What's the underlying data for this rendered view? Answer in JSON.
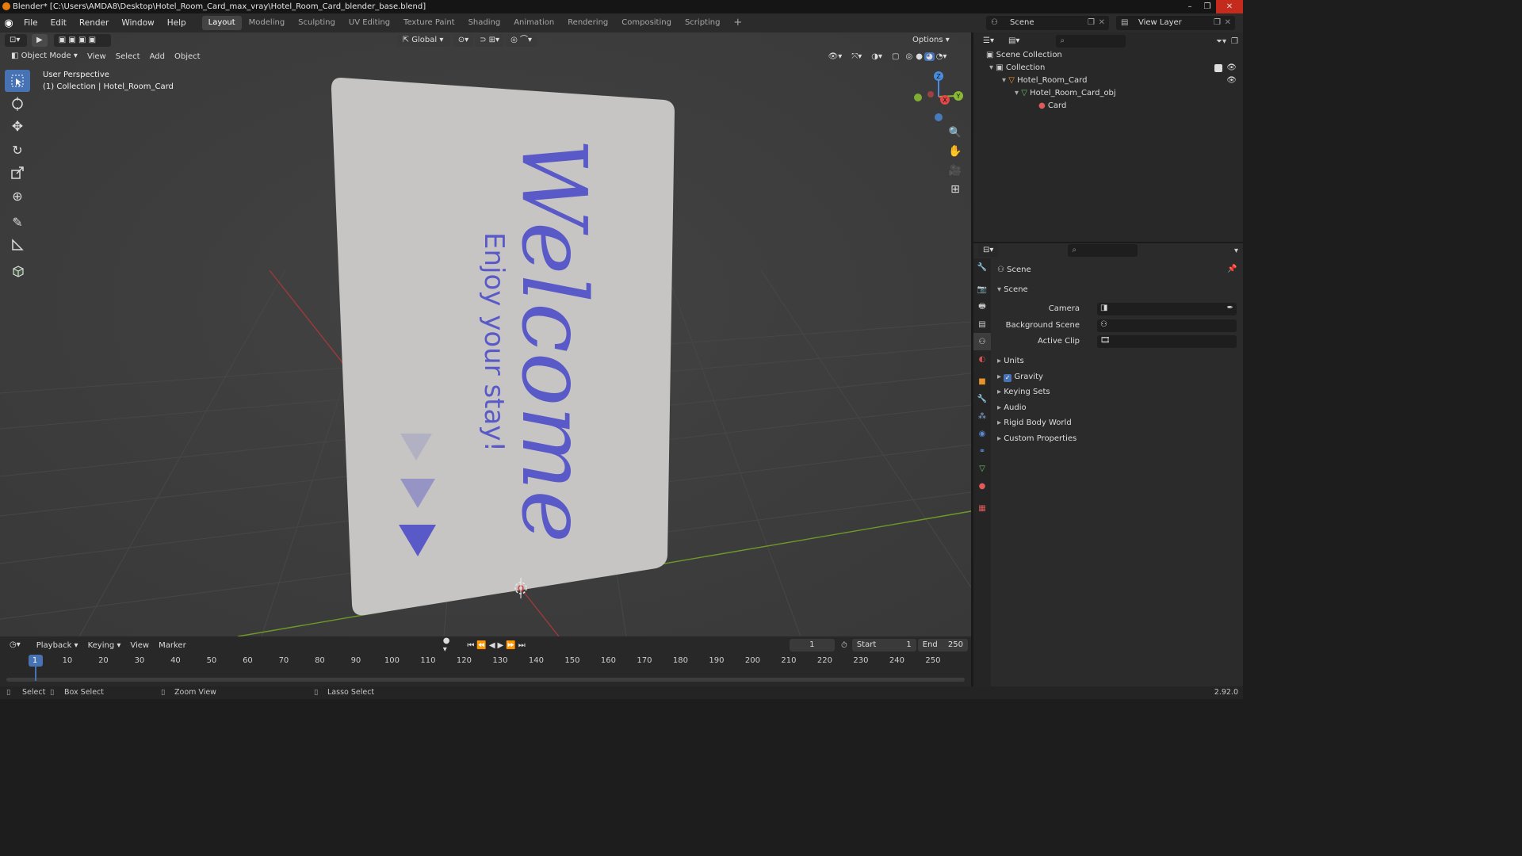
{
  "window": {
    "title": "Blender* [C:\\Users\\AMDA8\\Desktop\\Hotel_Room_Card_max_vray\\Hotel_Room_Card_blender_base.blend]",
    "controls": [
      "–",
      "❐",
      "✕"
    ]
  },
  "menubar": {
    "menus": [
      "File",
      "Edit",
      "Render",
      "Window",
      "Help"
    ],
    "workspaces": [
      "Layout",
      "Modeling",
      "Sculpting",
      "UV Editing",
      "Texture Paint",
      "Shading",
      "Animation",
      "Rendering",
      "Compositing",
      "Scripting"
    ],
    "active_workspace": "Layout",
    "add_workspace": "+",
    "scene": "Scene",
    "view_layer": "View Layer"
  },
  "viewport": {
    "transform_orientation": "Global",
    "options_label": "Options",
    "mode": "Object Mode",
    "menus": [
      "View",
      "Select",
      "Add",
      "Object"
    ],
    "overlay_title": "User Perspective",
    "overlay_collection": "(1) Collection | Hotel_Room_Card",
    "card_text_main": "Welcome",
    "card_text_sub": "Enjoy your stay!",
    "gizmo_axes": [
      "X",
      "Y",
      "Z"
    ],
    "colors": {
      "background": "#3d3d3d",
      "card": "#c6c5c4",
      "text": "#5a59c8",
      "x_axis": "#b03a3a",
      "y_axis": "#6f9a28",
      "active_tool": "#4772b3"
    }
  },
  "toolbar": {
    "tools": [
      "select-box",
      "cursor",
      "move",
      "rotate",
      "scale",
      "transform",
      "annotate",
      "measure",
      "add-cube"
    ],
    "active": "select-box"
  },
  "outliner": {
    "items": [
      {
        "label": "Scene Collection",
        "depth": 0
      },
      {
        "label": "Collection",
        "depth": 1
      },
      {
        "label": "Hotel_Room_Card",
        "depth": 2
      },
      {
        "label": "Hotel_Room_Card_obj",
        "depth": 3
      },
      {
        "label": "Card",
        "depth": 4
      }
    ]
  },
  "properties": {
    "context": "Scene",
    "panel_title": "Scene",
    "fields": [
      {
        "label": "Camera",
        "value": ""
      },
      {
        "label": "Background Scene",
        "value": ""
      },
      {
        "label": "Active Clip",
        "value": ""
      }
    ],
    "subpanels": [
      "Units",
      "Gravity",
      "Keying Sets",
      "Audio",
      "Rigid Body World",
      "Custom Properties"
    ],
    "gravity_checked": true
  },
  "timeline": {
    "menus": [
      "Playback",
      "Keying",
      "View",
      "Marker"
    ],
    "current_frame": "1",
    "start_label": "Start",
    "start": "1",
    "end_label": "End",
    "end": "250",
    "ruler": [
      "1",
      "10",
      "20",
      "30",
      "40",
      "50",
      "60",
      "70",
      "80",
      "90",
      "100",
      "110",
      "120",
      "130",
      "140",
      "150",
      "160",
      "170",
      "180",
      "190",
      "200",
      "210",
      "220",
      "230",
      "240",
      "250"
    ]
  },
  "statusbar": {
    "select": "Select",
    "box_select": "Box Select",
    "zoom_view": "Zoom View",
    "lasso_select": "Lasso Select",
    "version": "2.92.0"
  }
}
